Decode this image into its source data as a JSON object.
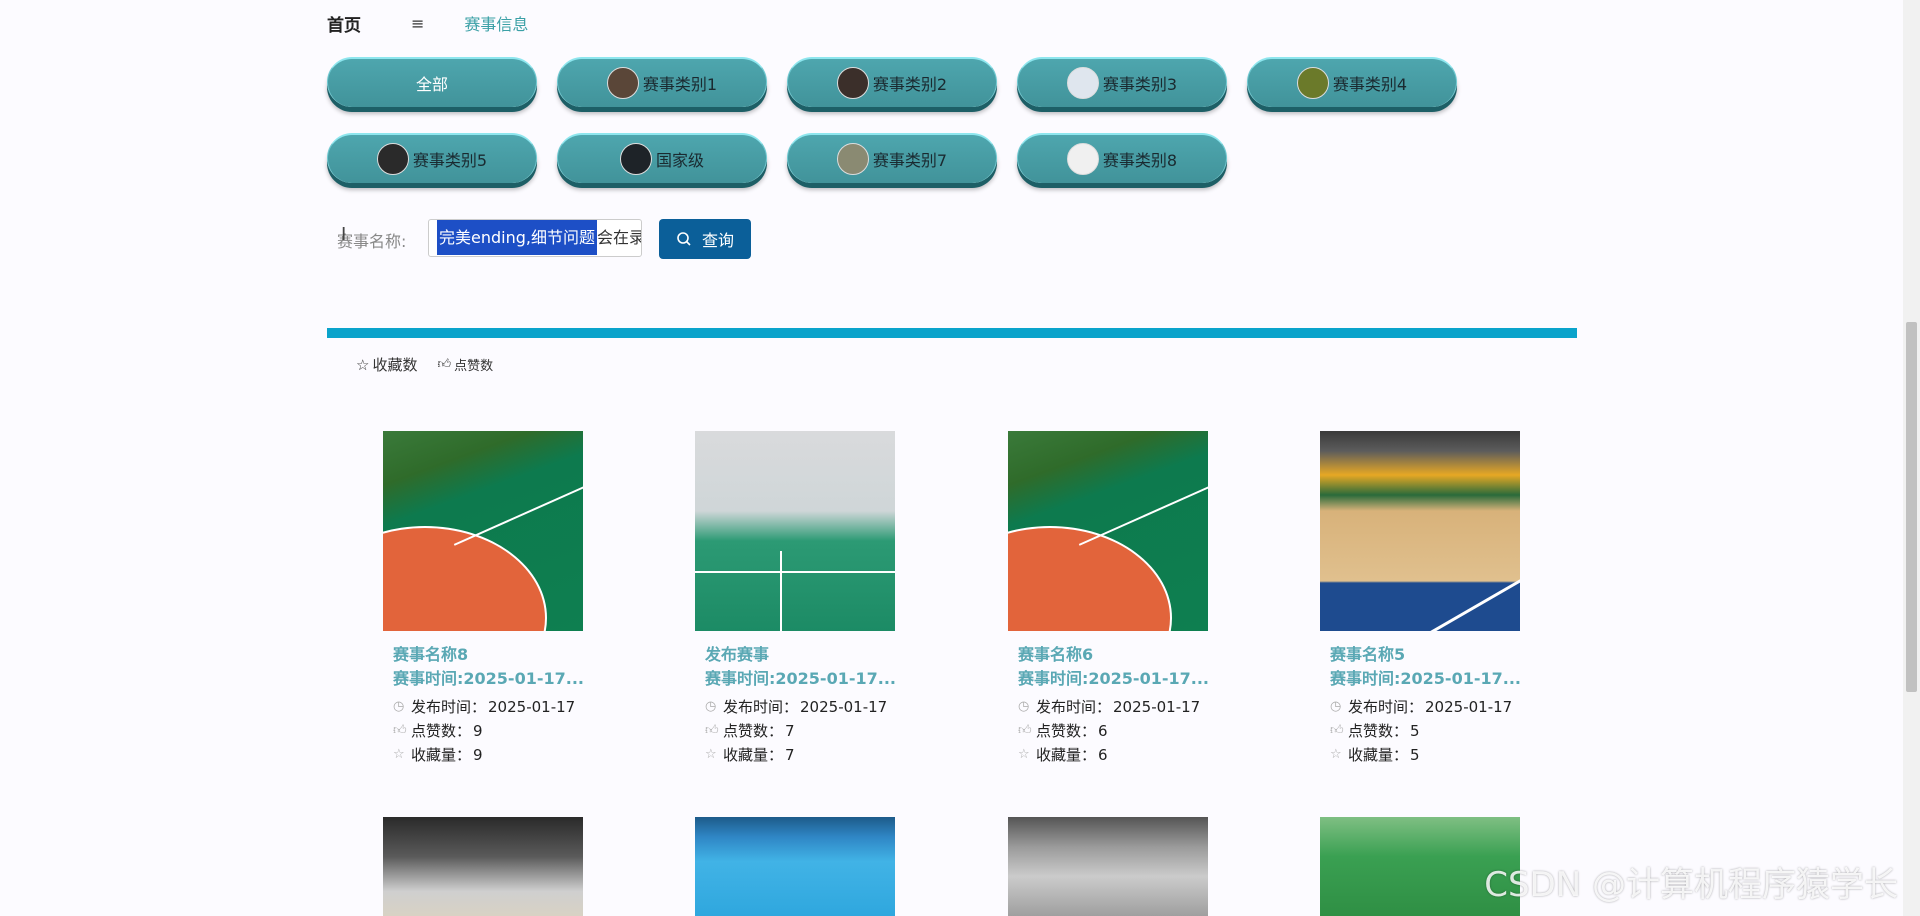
{
  "nav": {
    "home": "首页",
    "menu_icon": "≡",
    "match_info": "赛事信息"
  },
  "categories": [
    {
      "label": "全部",
      "thumb": "",
      "color": "#4ea6ae"
    },
    {
      "label": "赛事类别1",
      "thumb": "#5a4638"
    },
    {
      "label": "赛事类别2",
      "thumb": "#3b2f2a"
    },
    {
      "label": "赛事类别3",
      "thumb": "#dfe6ee"
    },
    {
      "label": "赛事类别4",
      "thumb": "#6b7a2a"
    },
    {
      "label": "赛事类别5",
      "thumb": "#2a2a2a"
    },
    {
      "label": "国家级",
      "thumb": "#1e2328"
    },
    {
      "label": "赛事类别7",
      "thumb": "#8a8a72"
    },
    {
      "label": "赛事类别8",
      "thumb": "#f0f0f0"
    }
  ],
  "search": {
    "label": "赛事名称:",
    "selected_text": "完美ending,细节问题",
    "rest_text": "会在录",
    "button_label": "查询"
  },
  "sort": {
    "favorites": "收藏数",
    "likes": "点赞数"
  },
  "cards": [
    {
      "title": "赛事名称8",
      "time": "赛事时间:2025-01-17...",
      "publish_label": "发布时间：",
      "publish": "2025-01-17",
      "likes_label": "点赞数：",
      "likes": "9",
      "fav_label": "收藏量：",
      "favs": "9"
    },
    {
      "title": "发布赛事",
      "time": "赛事时间:2025-01-17...",
      "publish_label": "发布时间：",
      "publish": "2025-01-17",
      "likes_label": "点赞数：",
      "likes": "7",
      "fav_label": "收藏量：",
      "favs": "7"
    },
    {
      "title": "赛事名称6",
      "time": "赛事时间:2025-01-17...",
      "publish_label": "发布时间：",
      "publish": "2025-01-17",
      "likes_label": "点赞数：",
      "likes": "6",
      "fav_label": "收藏量：",
      "favs": "6"
    },
    {
      "title": "赛事名称5",
      "time": "赛事时间:2025-01-17...",
      "publish_label": "发布时间：",
      "publish": "2025-01-17",
      "likes_label": "点赞数：",
      "likes": "5",
      "fav_label": "收藏量：",
      "favs": "5"
    }
  ],
  "watermark": "CSDN @计算机程序猿学长",
  "colors": {
    "accent": "#0aa3cb",
    "button": "#0b5f99",
    "title": "#5aa8b4",
    "category": "#4ea6ae"
  }
}
